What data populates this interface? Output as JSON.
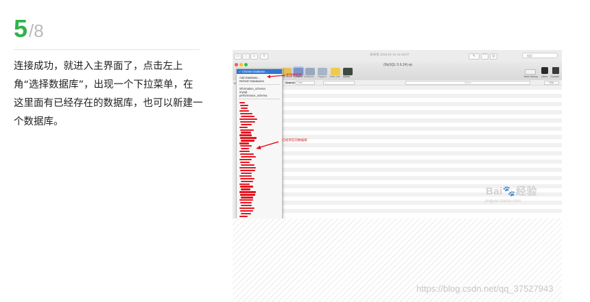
{
  "step": {
    "number": "5",
    "total": "/8"
  },
  "description": "连接成功，就进入主界面了，点击左上角“选择数据库”，出现一个下拉菜单，在这里面有已经存在的数据库，也可以新建一个数据库。",
  "app": {
    "tab_title": "未命名 2016-01-24 11:49:07",
    "connection_title": "(MySQL 5.6.24) ep",
    "search_placeholder": "搜索",
    "toolbar_items": [
      {
        "label": "Structure"
      },
      {
        "label": "Content"
      },
      {
        "label": "Relations"
      },
      {
        "label": "Triggers"
      },
      {
        "label": "Table Info"
      },
      {
        "label": "Query"
      }
    ],
    "toolbar_right": [
      {
        "label": "Table History"
      },
      {
        "label": "Users"
      },
      {
        "label": "Console"
      }
    ],
    "database_menu": {
      "selected": "✓ Choose Database...",
      "actions": [
        "Add Database...",
        "Refresh Databases"
      ],
      "databases": [
        "information_schema",
        "mysql",
        "performance_schema"
      ]
    },
    "filter_tag": "TAB",
    "search_bar": {
      "label": "Search:",
      "field_select": "Field",
      "operator_select": "=",
      "search_placeholder": "Search",
      "filter_button": "Filter"
    },
    "annotations": {
      "new_database": "新建数据库",
      "existing_databases": "已经存在的数据库"
    },
    "colors": {
      "step_green": "#2fb34a",
      "selection_blue": "#2f76d2",
      "annotation_red": "#e5141e"
    }
  },
  "watermarks": {
    "baidu": "Bai🐾经验",
    "jingyan": "jingyan.baidu.com",
    "csdn": "https://blog.csdn.net/qq_37527943"
  }
}
